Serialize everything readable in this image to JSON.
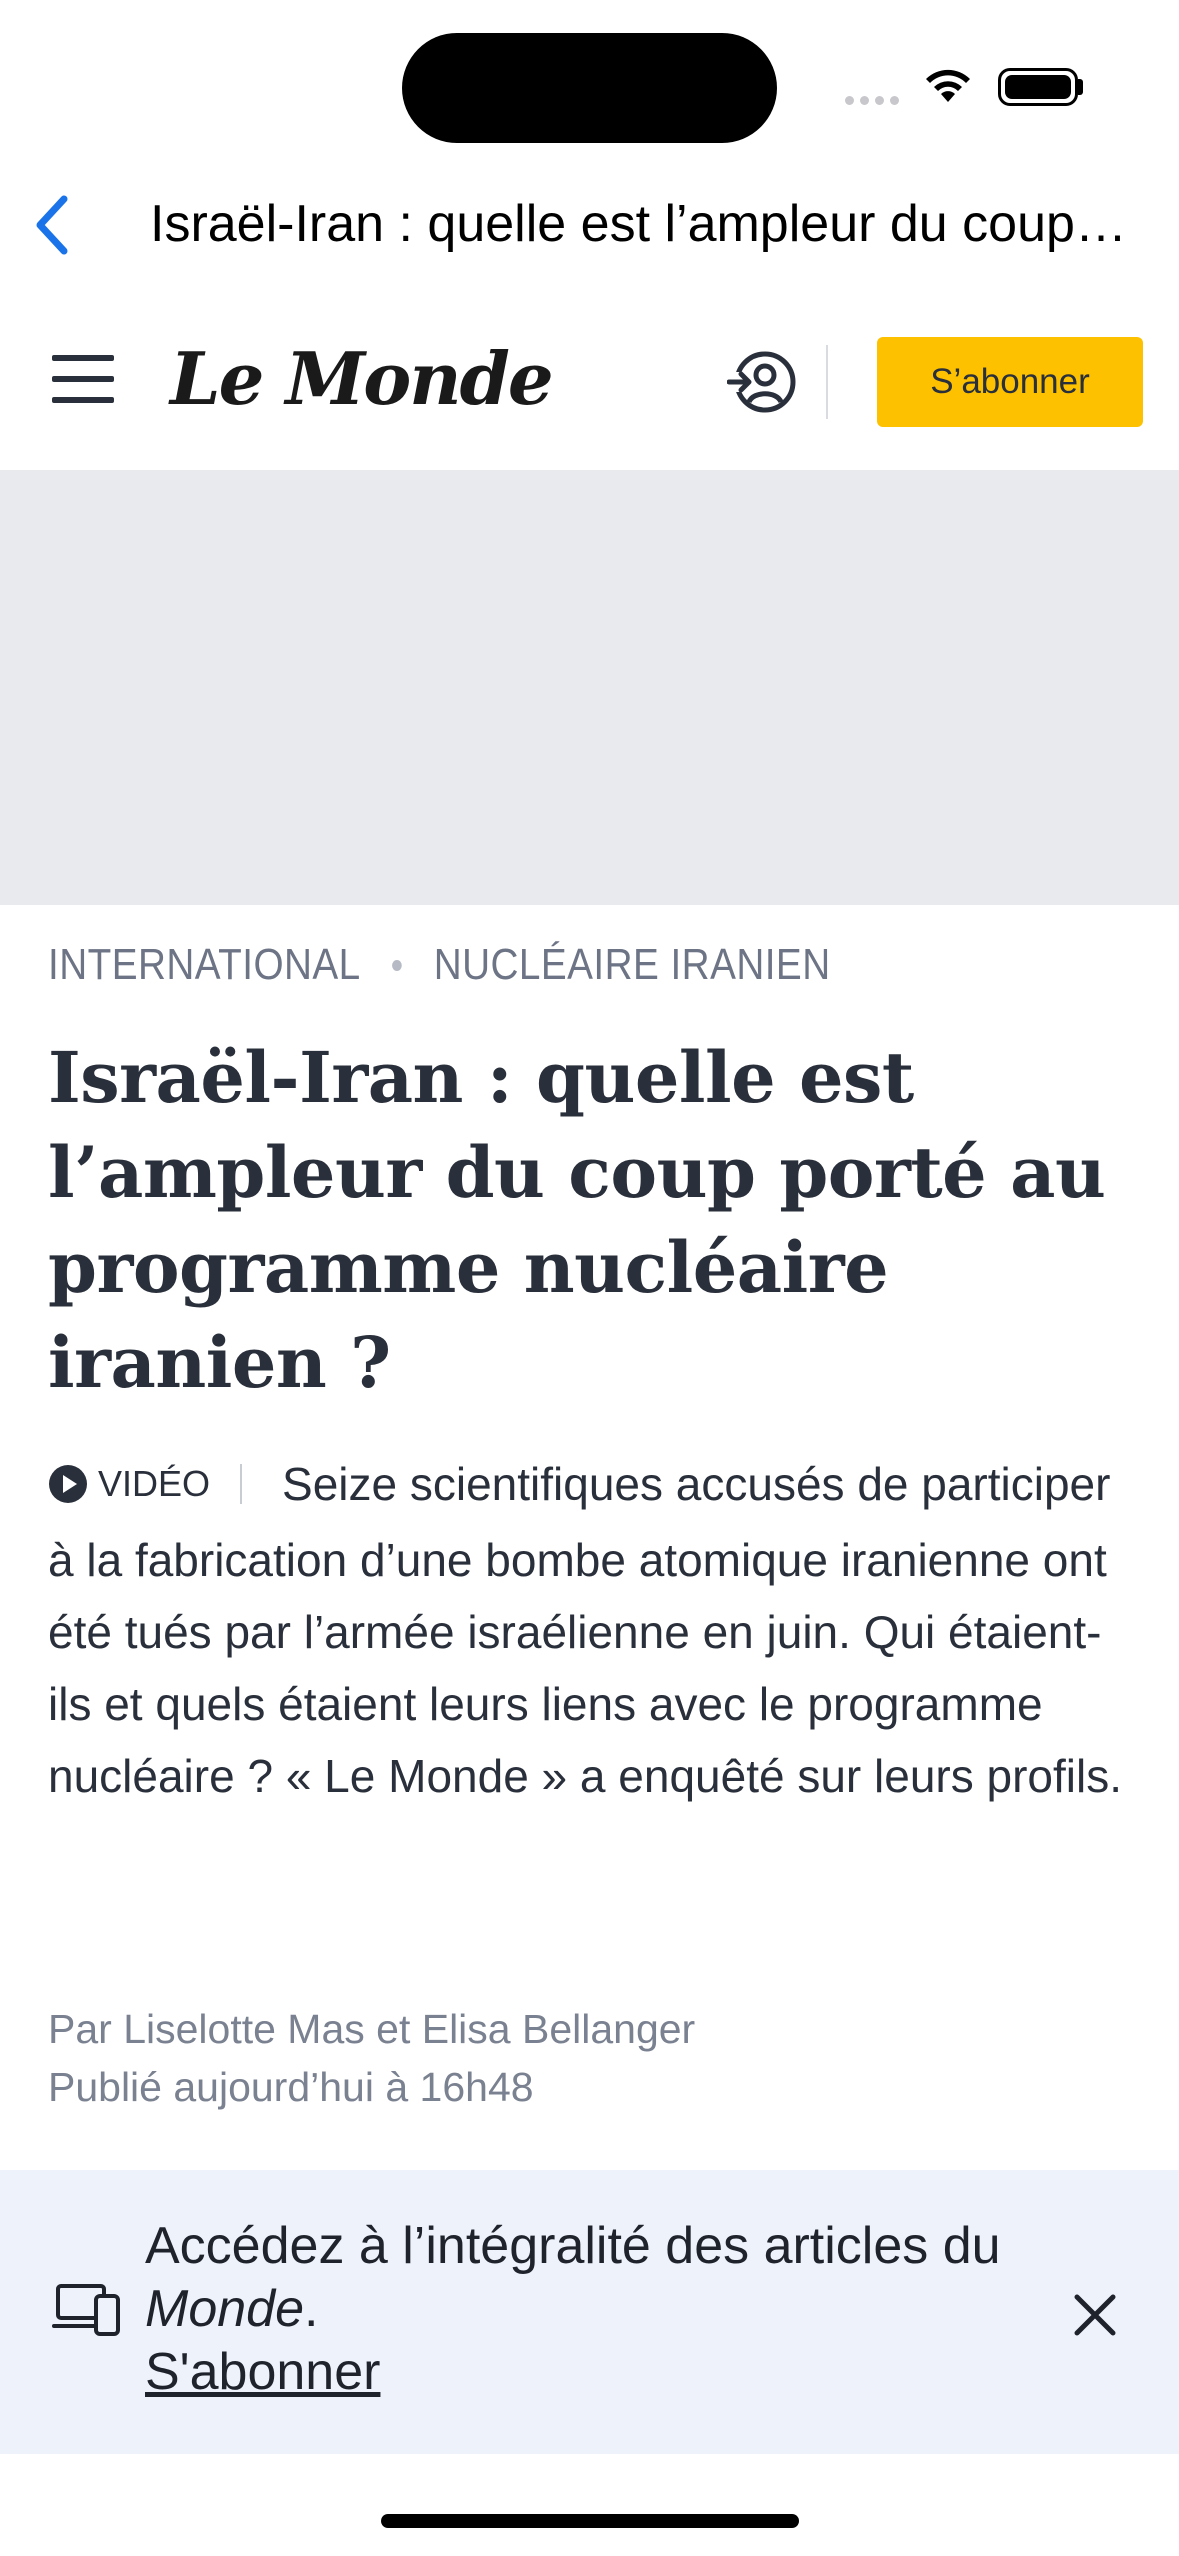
{
  "nav": {
    "title": "Israël-Iran : quelle est l’ampleur du coup porté au programme nucléaire iranien ?"
  },
  "header": {
    "logo": "Le Monde",
    "subscribe_label": "S’abonner"
  },
  "article": {
    "section": "INTERNATIONAL",
    "topic": "NUCLÉAIRE IRANIEN",
    "headline": "Israël-Iran : quelle est l’ampleur du coup porté au programme nucléaire iranien ?",
    "video_tag": "VIDÉO",
    "lede": "Seize scientifiques accusés de participer à la fabrication d’une bombe atomique iranienne ont été tués par l’armée israélienne en juin. Qui étaient-ils et quels étaient leurs liens avec le programme nucléaire ? « Le Monde » a enquêté sur leurs profils.",
    "byline": "Par Liselotte Mas et Elisa Bellanger",
    "published": "Publié aujourd’hui à 16h48"
  },
  "banner": {
    "text_before": "Accédez à l’intégralité des articles du ",
    "text_italic": "Monde",
    "text_after": ".",
    "link_label": "S'abonner"
  },
  "colors": {
    "subscribe_bg": "#fec100",
    "back_accent": "#1a73e8",
    "ad_bg": "#e9eaee",
    "banner_bg": "#eef2fa"
  }
}
